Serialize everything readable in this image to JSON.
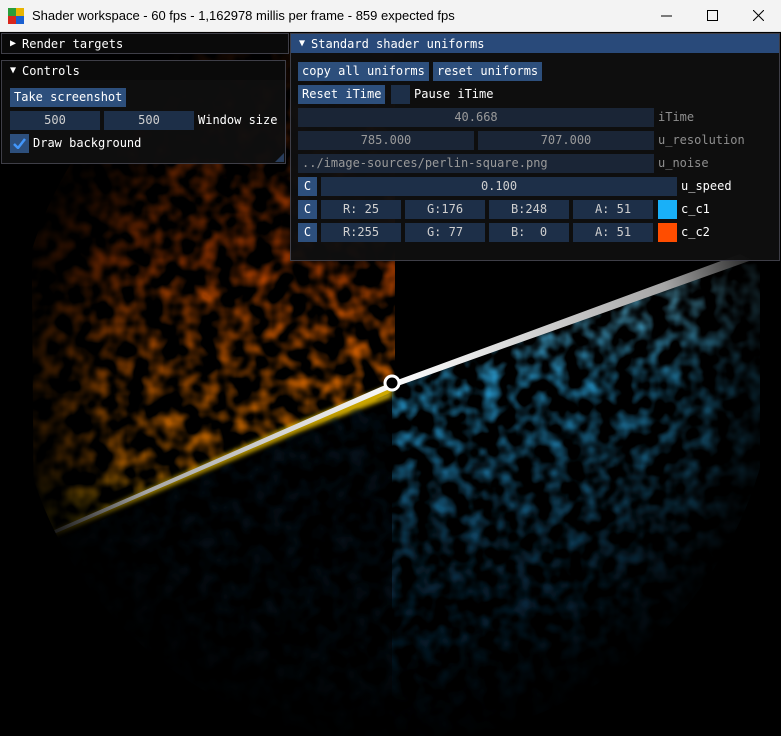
{
  "window": {
    "title": "Shader workspace - 60 fps - 1,162978 millis per frame - 859 expected fps",
    "icon": "app-color-grid-icon",
    "minimize_icon": "minimize-icon",
    "maximize_icon": "maximize-icon",
    "close_icon": "close-icon"
  },
  "render_targets": {
    "title": "Render targets",
    "icon": "collapsed-triangle-icon"
  },
  "controls": {
    "title": "Controls",
    "icon": "expanded-triangle-icon",
    "screenshot_label": "Take screenshot",
    "width_value": "500",
    "height_value": "500",
    "window_size_label": "Window size",
    "draw_background_label": "Draw background",
    "draw_background_checked": true
  },
  "uniforms": {
    "title": "Standard shader uniforms",
    "icon": "expanded-triangle-icon",
    "copy_label": "copy all uniforms",
    "reset_label": "reset uniforms",
    "reset_itime_label": "Reset iTime",
    "pause_itime_label": "Pause iTime",
    "pause_itime_checked": false,
    "itime": {
      "value": "40.668",
      "name": "iTime"
    },
    "resolution": {
      "x": "785.000",
      "y": "707.000",
      "name": "u_resolution"
    },
    "noise": {
      "value": "../image-sources/perlin-square.png",
      "name": "u_noise"
    },
    "speed": {
      "c": "C",
      "value": "0.100",
      "name": "u_speed"
    },
    "c1": {
      "c": "C",
      "r": "R: 25",
      "g": "G:176",
      "b": "B:248",
      "a": "A: 51",
      "color": "#19b0f8",
      "name": "c_c1"
    },
    "c2": {
      "c": "C",
      "r": "R:255",
      "g": "G: 77",
      "b": "B:  0",
      "a": "A: 51",
      "color": "#ff4d00",
      "name": "c_c2"
    }
  },
  "colors": {
    "accent": "#294a7a",
    "button": "#2d4f7c",
    "frame": "#1d2f48",
    "orange": "#ff6a00",
    "blue": "#19b0f8"
  }
}
